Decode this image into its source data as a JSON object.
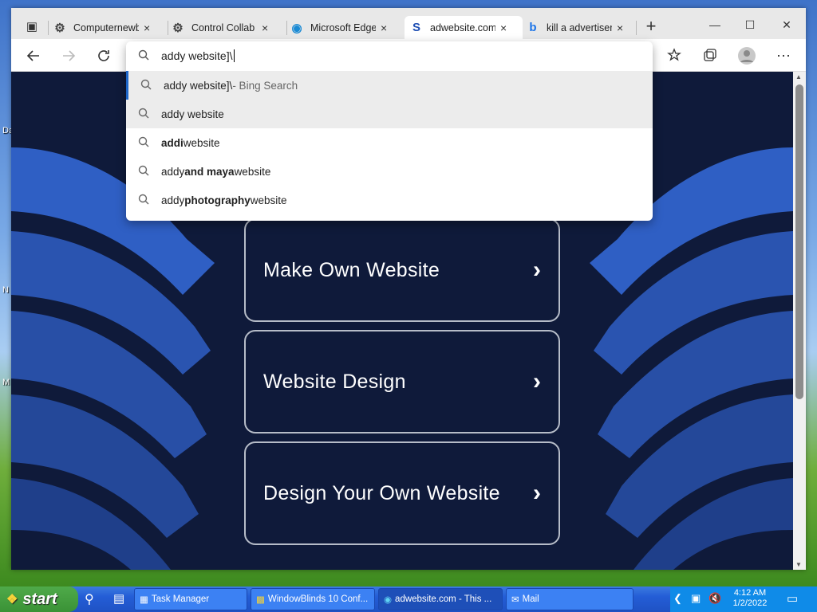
{
  "desktop": {
    "fragments": [
      "Da",
      "N",
      "M"
    ]
  },
  "browser": {
    "tabs": [
      {
        "label": "Computernewb",
        "close": "×"
      },
      {
        "label": "Control Collab",
        "close": "×"
      },
      {
        "label": "Microsoft Edge",
        "close": "×"
      },
      {
        "label": "adwebsite.com",
        "close": "×"
      },
      {
        "label": "kill a advertiser",
        "close": "×"
      }
    ],
    "new_tab": "+",
    "window_controls": {
      "minimize": "—",
      "maximize": "☐",
      "close": "✕"
    },
    "address_value": "addy website]\\"
  },
  "omnibox": {
    "suggestions": [
      {
        "plain_before": "addy website]\\",
        "bold": "",
        "plain_after": "",
        "suffix": " - Bing Search"
      },
      {
        "plain_before": "addy website",
        "bold": "",
        "plain_after": "",
        "suffix": ""
      },
      {
        "plain_before": "",
        "bold": "addi",
        "plain_after": " website",
        "suffix": ""
      },
      {
        "plain_before": "addy ",
        "bold": "and maya",
        "plain_after": " website",
        "suffix": ""
      },
      {
        "plain_before": "addy ",
        "bold": "photography",
        "plain_after": " website",
        "suffix": ""
      }
    ]
  },
  "page": {
    "buttons": [
      {
        "text": "Make Own Website",
        "arrow": "›"
      },
      {
        "text": "Website Design",
        "arrow": "›"
      },
      {
        "text": "Design Your Own Website",
        "arrow": "›"
      }
    ]
  },
  "taskbar": {
    "start": "start",
    "tasks": [
      {
        "label": "Task Manager"
      },
      {
        "label": "WindowBlinds 10 Conf..."
      },
      {
        "label": "adwebsite.com - This ..."
      },
      {
        "label": "Mail"
      }
    ],
    "clock": {
      "time": "4:12 AM",
      "date": "1/2/2022"
    }
  },
  "colors": {
    "page_bg": "#0f1a3a",
    "accent_blue": "#1e66c8",
    "wave_blue": "#2f5fc4"
  }
}
